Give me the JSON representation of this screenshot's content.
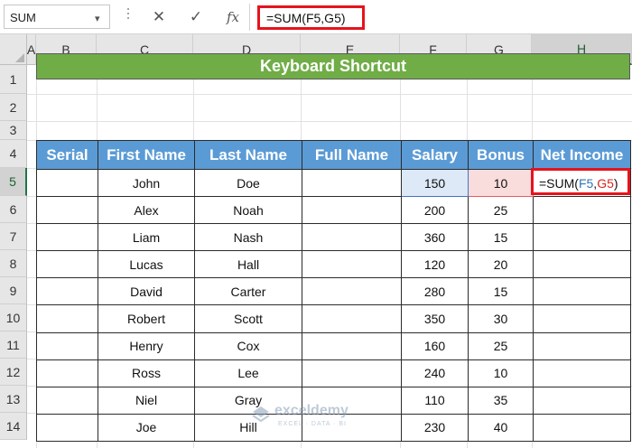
{
  "formula_bar": {
    "name_box": "SUM",
    "name_box_arrow": "▾",
    "cancel_icon": "✕",
    "enter_icon": "✓",
    "function_icon": "fx",
    "formula": "=SUM(F5,G5)"
  },
  "columns": [
    "A",
    "B",
    "C",
    "D",
    "E",
    "F",
    "G",
    "H"
  ],
  "rows": [
    "1",
    "2",
    "3",
    "4",
    "5",
    "6",
    "7",
    "8",
    "9",
    "10",
    "11",
    "12",
    "13",
    "14"
  ],
  "selected_column": "H",
  "selected_row": "5",
  "title": "Keyboard Shortcut",
  "table": {
    "headers": [
      "Serial",
      "First Name",
      "Last Name",
      "Full Name",
      "Salary",
      "Bonus",
      "Net Income"
    ],
    "rows": [
      {
        "serial": "",
        "first": "John",
        "last": "Doe",
        "full": "",
        "salary": "150",
        "bonus": "10",
        "net": ""
      },
      {
        "serial": "",
        "first": "Alex",
        "last": "Noah",
        "full": "",
        "salary": "200",
        "bonus": "25",
        "net": ""
      },
      {
        "serial": "",
        "first": "Liam",
        "last": "Nash",
        "full": "",
        "salary": "360",
        "bonus": "15",
        "net": ""
      },
      {
        "serial": "",
        "first": "Lucas",
        "last": "Hall",
        "full": "",
        "salary": "120",
        "bonus": "20",
        "net": ""
      },
      {
        "serial": "",
        "first": "David",
        "last": "Carter",
        "full": "",
        "salary": "280",
        "bonus": "15",
        "net": ""
      },
      {
        "serial": "",
        "first": "Robert",
        "last": "Scott",
        "full": "",
        "salary": "350",
        "bonus": "30",
        "net": ""
      },
      {
        "serial": "",
        "first": "Henry",
        "last": "Cox",
        "full": "",
        "salary": "160",
        "bonus": "25",
        "net": ""
      },
      {
        "serial": "",
        "first": "Ross",
        "last": "Lee",
        "full": "",
        "salary": "240",
        "bonus": "10",
        "net": ""
      },
      {
        "serial": "",
        "first": "Niel",
        "last": "Gray",
        "full": "",
        "salary": "110",
        "bonus": "35",
        "net": ""
      },
      {
        "serial": "",
        "first": "Joe",
        "last": "Hill",
        "full": "",
        "salary": "230",
        "bonus": "40",
        "net": ""
      }
    ]
  },
  "active_cell": {
    "prefix": "=SUM(",
    "ref1": "F5",
    "comma": ",",
    "ref2": "G5",
    "suffix": ")"
  },
  "watermark": {
    "name": "exceldemy",
    "tagline": "EXCEL · DATA · BI"
  },
  "colors": {
    "header_fill": "#5b9bd5",
    "banner_fill": "#70ad47",
    "highlight_border": "#e5131d",
    "ref_f": "#2e75b6",
    "ref_g": "#d9261c"
  }
}
